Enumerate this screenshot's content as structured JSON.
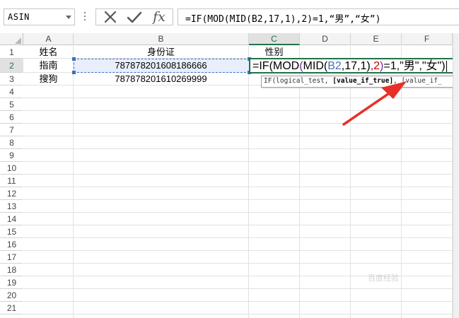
{
  "formula_bar": {
    "name_box": "ASIN",
    "cancel_icon": "close-icon",
    "enter_icon": "checkmark-icon",
    "function_label": "fx",
    "formula": "=IF(MOD(MID(B2,17,1),2)=1,“男”,“女”)"
  },
  "columns": [
    "A",
    "B",
    "C",
    "D",
    "E",
    "F"
  ],
  "active_column": "C",
  "rows": [
    "1",
    "2",
    "3",
    "4",
    "5",
    "6",
    "7",
    "8",
    "9",
    "10",
    "11",
    "12",
    "13",
    "14",
    "15",
    "16",
    "17",
    "18",
    "19",
    "20",
    "21"
  ],
  "active_row": "2",
  "cells": {
    "A1": "姓名",
    "B1": "身份证",
    "C1": "性别",
    "A2": "指南",
    "B2": "787878201608186666",
    "A3": "搜狗",
    "B3": "787878201610269999"
  },
  "editing_cell": {
    "address": "C2",
    "parts": {
      "p1": "=IF(MOD",
      "p2": "(",
      "p3": "MID(",
      "p4": "B2",
      "p5": ",17,1)",
      "p6": ",2",
      "p7": ")",
      "p8": "=1,\"男\",\"女\")"
    }
  },
  "tooltip": {
    "fn": "IF(",
    "arg1": "logical_test, ",
    "arg2": "[value_if_true]",
    "arg3": ", [value_if_"
  },
  "colors": {
    "accent_green": "#217346",
    "ref_blue": "#4472c4",
    "ref_red": "#c00000",
    "arrow_red": "#e8302a"
  },
  "watermark": "百度经验"
}
